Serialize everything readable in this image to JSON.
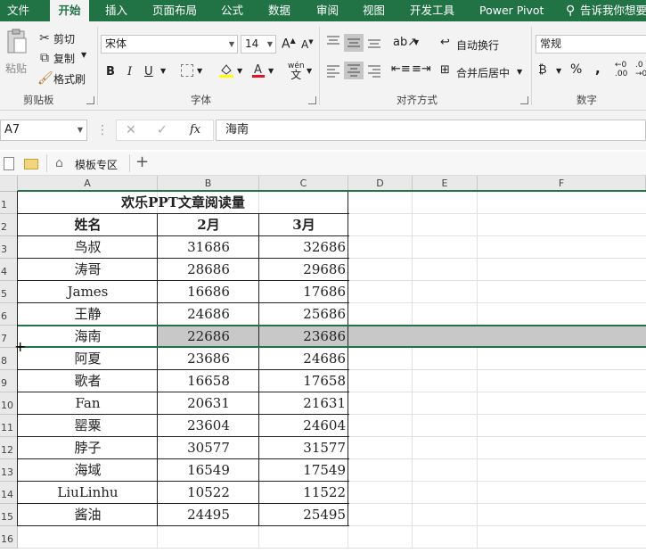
{
  "tabs": [
    "文件",
    "开始",
    "插入",
    "页面布局",
    "公式",
    "数据",
    "审阅",
    "视图",
    "开发工具",
    "Power Pivot",
    "告诉我你想要"
  ],
  "clipboard": {
    "paste": "粘贴",
    "cut": "剪切",
    "copy": "复制",
    "format_painter": "格式刷",
    "group": "剪贴板"
  },
  "font": {
    "name": "宋体",
    "size": "14",
    "bold": "B",
    "italic": "I",
    "underline": "U",
    "group": "字体"
  },
  "alignment": {
    "wrap": "自动换行",
    "merge": "合并后居中",
    "group": "对齐方式"
  },
  "number": {
    "format": "常规",
    "percent": "%",
    "comma": ",",
    "group": "数字"
  },
  "formula_bar": {
    "name_box": "A7",
    "fx": "fx",
    "content": "海南"
  },
  "template_tab": {
    "label": "模板专区",
    "add": "+"
  },
  "columns": [
    "A",
    "B",
    "C",
    "D",
    "E",
    "F"
  ],
  "rows": [
    "1",
    "2",
    "3",
    "4",
    "5",
    "6",
    "7",
    "8",
    "9",
    "10",
    "11",
    "12",
    "13",
    "14",
    "15",
    "16"
  ],
  "sheet": {
    "title": "欢乐PPT文章阅读量",
    "headers": [
      "姓名",
      "2月",
      "3月"
    ],
    "data": [
      [
        "鸟叔",
        "31686",
        "32686"
      ],
      [
        "涛哥",
        "28686",
        "29686"
      ],
      [
        "James",
        "16686",
        "17686"
      ],
      [
        "王静",
        "24686",
        "25686"
      ],
      [
        "海南",
        "22686",
        "23686"
      ],
      [
        "阿夏",
        "23686",
        "24686"
      ],
      [
        "歌者",
        "16658",
        "17658"
      ],
      [
        "Fan",
        "20631",
        "21631"
      ],
      [
        "罂粟",
        "23604",
        "24604"
      ],
      [
        "脖子",
        "30577",
        "31577"
      ],
      [
        "海域",
        "16549",
        "17549"
      ],
      [
        "LiuLinhu",
        "10522",
        "11522"
      ],
      [
        "酱油",
        "24495",
        "25495"
      ]
    ]
  },
  "colors": {
    "accent": "#217346",
    "selection": "#c8c8c8"
  }
}
